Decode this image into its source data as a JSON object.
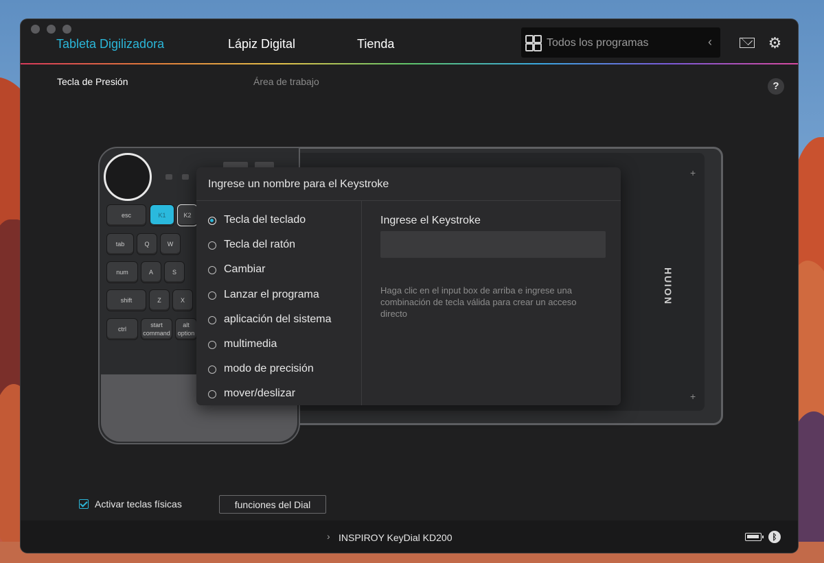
{
  "nav": {
    "tabs": [
      {
        "label": "Tableta Digilizadora",
        "active": true
      },
      {
        "label": "Lápiz Digital",
        "active": false
      },
      {
        "label": "Tienda",
        "active": false
      }
    ],
    "program_selector": "Todos los programas"
  },
  "subtabs": {
    "pressure_key": "Tecla de Presión",
    "work_area": "Área de trabajo",
    "help": "?"
  },
  "device": {
    "keys": [
      "esc",
      "K1",
      "K2",
      "tab",
      "Q",
      "W",
      "num",
      "A",
      "S",
      "shift",
      "Z",
      "X",
      "ctrl",
      "start\ncommand",
      "alt\noption"
    ],
    "brand": "HUION"
  },
  "dialog": {
    "title": "Ingrese un nombre para el Keystroke",
    "options": [
      {
        "label": "Tecla del teclado",
        "selected": true
      },
      {
        "label": "Tecla del ratón",
        "selected": false
      },
      {
        "label": "Cambiar",
        "selected": false
      },
      {
        "label": "Lanzar el programa",
        "selected": false
      },
      {
        "label": "aplicación del sistema",
        "selected": false
      },
      {
        "label": "multimedia",
        "selected": false
      },
      {
        "label": "modo de precisión",
        "selected": false
      },
      {
        "label": "mover/deslizar",
        "selected": false
      }
    ],
    "keystroke_label": "Ingrese el Keystroke",
    "keystroke_value": "",
    "keystroke_help": "Haga clic en el input box de arriba e ingrese una combinación de tecla válida para crear un acceso directo"
  },
  "footer": {
    "enable_keys_label": "Activar teclas físicas",
    "enable_keys_checked": true,
    "dial_button": "funciones del Dial",
    "device_name": "INSPIROY KeyDial KD200"
  },
  "colors": {
    "accent": "#2bb7d9",
    "window_bg": "#1f1f20",
    "dialog_bg": "#2a2a2c"
  }
}
